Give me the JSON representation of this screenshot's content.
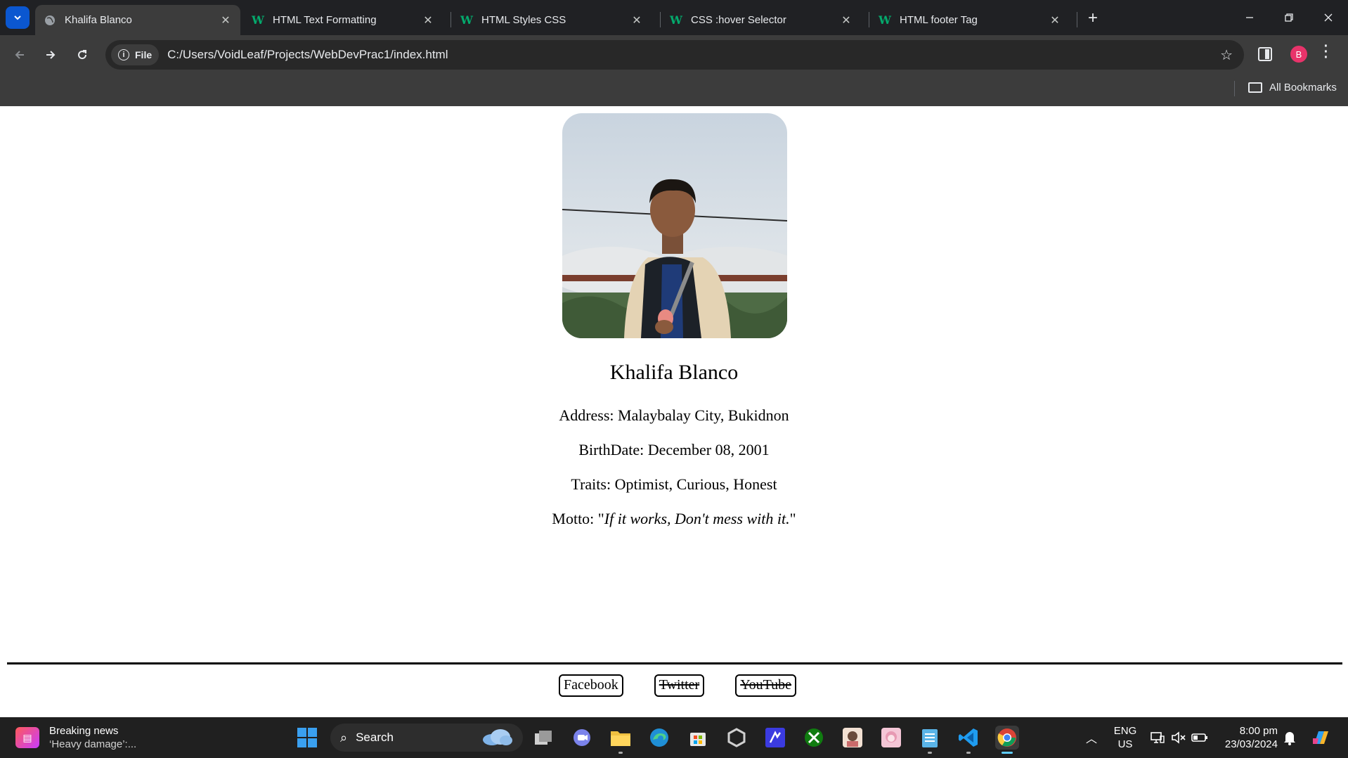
{
  "browser": {
    "tabs": [
      {
        "title": "Khalifa Blanco",
        "active": true,
        "icon": "globe-icon"
      },
      {
        "title": "HTML Text Formatting",
        "active": false,
        "icon": "w3schools-icon"
      },
      {
        "title": "HTML Styles CSS",
        "active": false,
        "icon": "w3schools-icon"
      },
      {
        "title": "CSS :hover Selector",
        "active": false,
        "icon": "w3schools-icon"
      },
      {
        "title": "HTML footer Tag",
        "active": false,
        "icon": "w3schools-icon"
      }
    ],
    "favicon_letter": "W",
    "address_chip": "File",
    "url": "C:/Users/VoidLeaf/Projects/WebDevPrac1/index.html",
    "profile_initial": "B",
    "bookmarks_label": "All Bookmarks",
    "accent": "#0b57d0"
  },
  "profile": {
    "name": "Khalifa Blanco",
    "address_label": "Address:",
    "address": "Malaybalay City, Bukidnon",
    "birthdate_label": "BirthDate:",
    "birthdate": "December 08, 2001",
    "traits_label": "Traits:",
    "traits": "Optimist, Curious, Honest",
    "motto_label": "Motto:",
    "motto": "If it works, Don't mess with it."
  },
  "footer": {
    "links": [
      {
        "label": "Facebook",
        "struck": false
      },
      {
        "label": "Twitter",
        "struck": true
      },
      {
        "label": "YouTube",
        "struck": true
      }
    ]
  },
  "taskbar": {
    "news_title": "Breaking news",
    "news_sub": "‘Heavy damage’:...",
    "search_placeholder": "Search",
    "lang_1": "ENG",
    "lang_2": "US",
    "time": "8:00 pm",
    "date": "23/03/2024"
  }
}
